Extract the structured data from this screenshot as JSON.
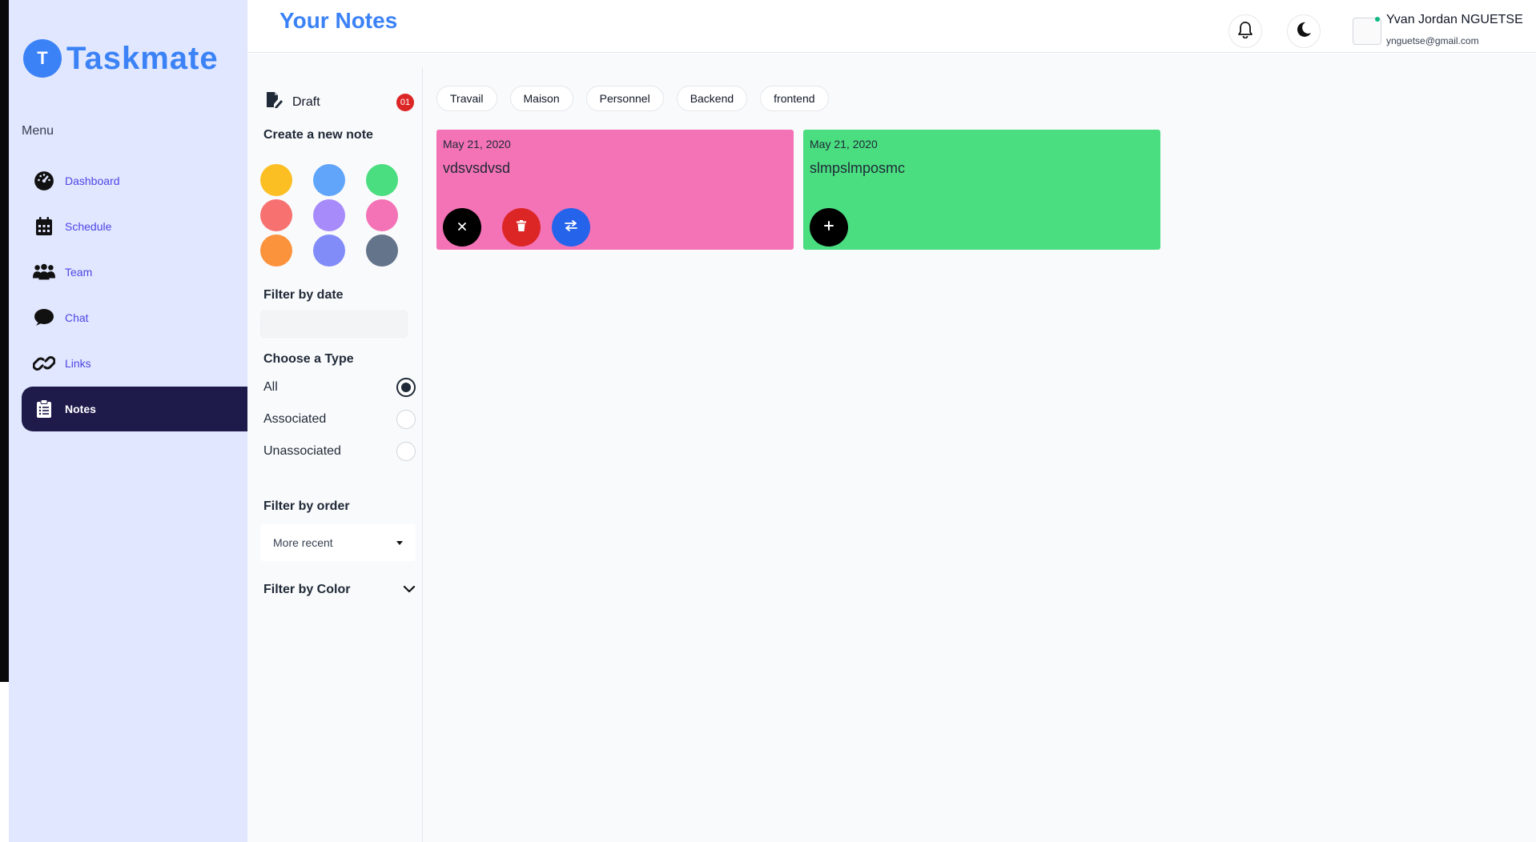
{
  "app": {
    "name": "Taskmate",
    "logo_letter": "T"
  },
  "sidebar": {
    "menu_label": "Menu",
    "items": [
      {
        "label": "Dashboard",
        "icon": "dashboard-gauge-icon"
      },
      {
        "label": "Schedule",
        "icon": "calendar-icon"
      },
      {
        "label": "Team",
        "icon": "team-icon"
      },
      {
        "label": "Chat",
        "icon": "chat-bubble-icon"
      },
      {
        "label": "Links",
        "icon": "link-icon"
      },
      {
        "label": "Notes",
        "icon": "notes-clipboard-icon",
        "active": true
      }
    ]
  },
  "header": {
    "title": "Your Notes",
    "user": {
      "name": "Yvan Jordan NGUETSE",
      "email": "ynguetse@gmail.com"
    }
  },
  "filters": {
    "draft": {
      "label": "Draft",
      "count": "01"
    },
    "create_note_label": "Create a new note",
    "colors": [
      "#fbbf24",
      "#60a5fa",
      "#4ade80",
      "#f87171",
      "#a78bfa",
      "#f472b6",
      "#fb923c",
      "#818cf8",
      "#64748b"
    ],
    "filter_date_label": "Filter by date",
    "type_label": "Choose a Type",
    "types": [
      {
        "label": "All",
        "checked": true
      },
      {
        "label": "Associated",
        "checked": false
      },
      {
        "label": "Unassociated",
        "checked": false
      }
    ],
    "order_label": "Filter by order",
    "order_value": "More recent",
    "color_filter_label": "Filter by Color"
  },
  "tags": [
    "Travail",
    "Maison",
    "Personnel",
    "Backend",
    "frontend"
  ],
  "notes": [
    {
      "date": "May 21, 2020",
      "title": "vdsvsdvsd",
      "color": "#f472b6"
    },
    {
      "date": "May 21, 2020",
      "title": "slmpslmposmc",
      "color": "#4ade80"
    }
  ]
}
